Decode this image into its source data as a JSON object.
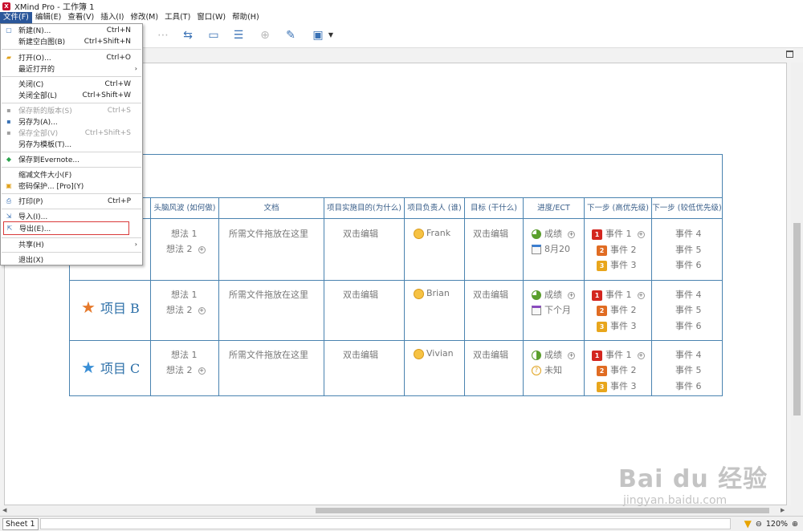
{
  "window": {
    "title": "XMind Pro - 工作簿 1"
  },
  "menubar": [
    "文件(F)",
    "编辑(E)",
    "查看(V)",
    "插入(I)",
    "修改(M)",
    "工具(T)",
    "窗口(W)",
    "帮助(H)"
  ],
  "file_menu": [
    {
      "label": "新建(N)...",
      "shortcut": "Ctrl+N"
    },
    {
      "label": "新建空白图(B)",
      "shortcut": "Ctrl+Shift+N"
    },
    {
      "label": "打开(O)...",
      "shortcut": "Ctrl+O"
    },
    {
      "label": "最近打开的",
      "shortcut": ""
    },
    {
      "label": "关闭(C)",
      "shortcut": "Ctrl+W"
    },
    {
      "label": "关闭全部(L)",
      "shortcut": "Ctrl+Shift+W"
    },
    {
      "label": "保存新的版本(S)",
      "shortcut": "Ctrl+S"
    },
    {
      "label": "另存为(A)...",
      "shortcut": ""
    },
    {
      "label": "保存全部(V)",
      "shortcut": "Ctrl+Shift+S"
    },
    {
      "label": "另存为模板(T)...",
      "shortcut": ""
    },
    {
      "label": "保存到Evernote...",
      "shortcut": ""
    },
    {
      "label": "缩减文件大小(F)",
      "shortcut": ""
    },
    {
      "label": "密码保护... [Pro](Y)",
      "shortcut": ""
    },
    {
      "label": "打印(P)",
      "shortcut": "Ctrl+P"
    },
    {
      "label": "导入(I)...",
      "shortcut": ""
    },
    {
      "label": "导出(E)...",
      "shortcut": ""
    },
    {
      "label": "共享(H)",
      "shortcut": ""
    },
    {
      "label": "退出(X)",
      "shortcut": ""
    }
  ],
  "table": {
    "headers": [
      "头脑风波 (如何做)",
      "文档",
      "项目实施目的(为什么)",
      "项目负责人 (谁)",
      "目标 (干什么)",
      "进度/ECT",
      "下一步 (高优先级)",
      "下一步 (较低优先级)"
    ],
    "rows": [
      {
        "project": "",
        "ideas": [
          "想法 1",
          "想法 2"
        ],
        "doc": "所需文件拖放在这里",
        "purpose": "双击编辑",
        "owner": "Frank",
        "goal": "双击编辑",
        "progress": [
          "成绩",
          "8月20"
        ],
        "high": [
          "事件 1",
          "事件 2",
          "事件 3"
        ],
        "low": [
          "事件 4",
          "事件 5",
          "事件 6"
        ]
      },
      {
        "project": "项目 B",
        "ideas": [
          "想法 1",
          "想法 2"
        ],
        "doc": "所需文件拖放在这里",
        "purpose": "双击编辑",
        "owner": "Brian",
        "goal": "双击编辑",
        "progress": [
          "成绩",
          "下个月"
        ],
        "high": [
          "事件 1",
          "事件 2",
          "事件 3"
        ],
        "low": [
          "事件 4",
          "事件 5",
          "事件 6"
        ]
      },
      {
        "project": "项目 C",
        "ideas": [
          "想法 1",
          "想法 2"
        ],
        "doc": "所需文件拖放在这里",
        "purpose": "双击编辑",
        "owner": "Vivian",
        "goal": "双击编辑",
        "progress": [
          "成绩",
          "未知"
        ],
        "high": [
          "事件 1",
          "事件 2",
          "事件 3"
        ],
        "low": [
          "事件 4",
          "事件 5",
          "事件 6"
        ]
      }
    ]
  },
  "status": {
    "sheet": "Sheet 1",
    "zoom": "120%"
  },
  "colors": {
    "accent": "#2b579a",
    "table_border": "#4a83b0",
    "highlight": "#d93a3a"
  },
  "watermark": {
    "logo": "Bai du 经验",
    "url": "jingyan.baidu.com"
  }
}
